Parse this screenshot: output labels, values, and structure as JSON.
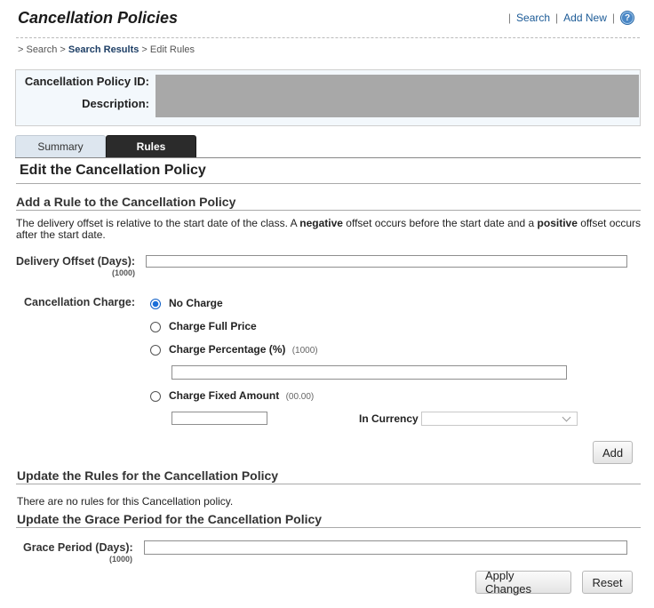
{
  "header": {
    "title": "Cancellation Policies",
    "links": {
      "search": "Search",
      "add_new": "Add New",
      "help_glyph": "?"
    }
  },
  "breadcrumb": {
    "prefix": "> Search > ",
    "current_link": "Search Results",
    "suffix": " > Edit Rules"
  },
  "info": {
    "id_label": "Cancellation Policy ID:",
    "description_label": "Description:"
  },
  "tabs": [
    {
      "label": "Summary",
      "active": false
    },
    {
      "label": "Rules",
      "active": true
    }
  ],
  "edit_title": "Edit the Cancellation Policy",
  "add_rule": {
    "title": "Add a Rule to the Cancellation Policy",
    "desc_part1": "The delivery offset is relative to the start date of the class. A ",
    "desc_neg": "negative",
    "desc_part2": " offset occurs before the start date and a ",
    "desc_pos": "positive",
    "desc_part3": " offset occurs after the start date.",
    "delivery_offset_label": "Delivery Offset (Days):",
    "delivery_offset_hint": "(1000)",
    "delivery_offset_value": "",
    "cancellation_label": "Cancellation Charge:",
    "options": {
      "no_charge": "No Charge",
      "full_price": "Charge Full Price",
      "percentage": "Charge Percentage (%)",
      "percentage_hint": "(1000)",
      "fixed": "Charge Fixed Amount",
      "fixed_hint": "(00.00)"
    },
    "selected_option": "No Charge",
    "percentage_value": "",
    "fixed_value": "",
    "currency_label": "In Currency",
    "currency_value": "",
    "add_button": "Add"
  },
  "update_rules": {
    "title": "Update the Rules for the Cancellation Policy",
    "empty_text": "There are no rules for this Cancellation policy."
  },
  "grace": {
    "title": "Update the Grace Period for the Cancellation Policy",
    "label": "Grace Period (Days):",
    "hint": "(1000)",
    "value": "",
    "apply_button": "Apply Changes",
    "reset_button": "Reset"
  },
  "colors": {
    "link": "#1b5a96",
    "panel_bg": "#f3f8fc",
    "redacted": "#a8a8a8",
    "active_tab": "#2b2b2b",
    "radio_checked": "#1b6fd9"
  }
}
